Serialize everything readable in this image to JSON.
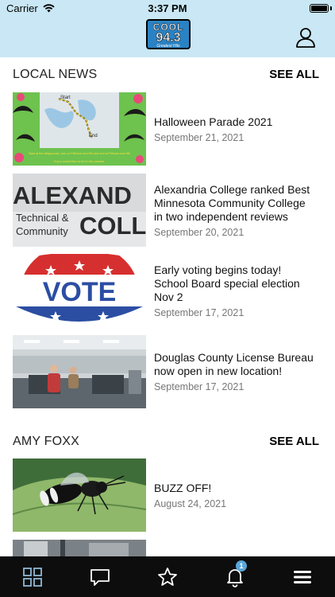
{
  "status_bar": {
    "carrier": "Carrier",
    "time": "3:37 PM"
  },
  "header": {
    "logo_top": "COOL",
    "logo_number": "94.3",
    "logo_tagline": "Greatest Hits"
  },
  "sections": [
    {
      "title": "LOCAL NEWS",
      "see_all": "SEE ALL",
      "items": [
        {
          "headline": "Halloween Parade 2021",
          "date": "September 21, 2021",
          "thumb_texts": [
            "Start",
            "End",
            "Start at the fairgrounds, turn on Fillmore and 5th and end at Fillmore and 9th",
            "If you would like to be in the parade,"
          ]
        },
        {
          "headline": "Alexandria College ranked Best Minnesota Community College in two independent reviews",
          "date": "September 20, 2021",
          "thumb_texts": [
            "ALEXAND",
            "Technical &",
            "COLL",
            "Community"
          ]
        },
        {
          "headline": "Early voting begins today! School Board special election Nov 2",
          "date": "September 17, 2021",
          "thumb_texts": [
            "VOTE"
          ]
        },
        {
          "headline": "Douglas County License Bureau now open in new location!",
          "date": "September 17, 2021",
          "thumb_texts": []
        }
      ]
    },
    {
      "title": "AMY FOXX",
      "see_all": "SEE ALL",
      "items": [
        {
          "headline": "BUZZ OFF!",
          "date": "August 24, 2021",
          "thumb_texts": []
        }
      ]
    }
  ],
  "tabbar": {
    "icons": [
      "grid-icon",
      "chat-icon",
      "star-icon",
      "bell-icon",
      "menu-icon"
    ],
    "notification_badge": "1"
  },
  "colors": {
    "header_bg": "#c9e7f4",
    "tabbar_bg": "#0d0d0d",
    "badge": "#5aa6d8",
    "date_text": "#777777"
  }
}
